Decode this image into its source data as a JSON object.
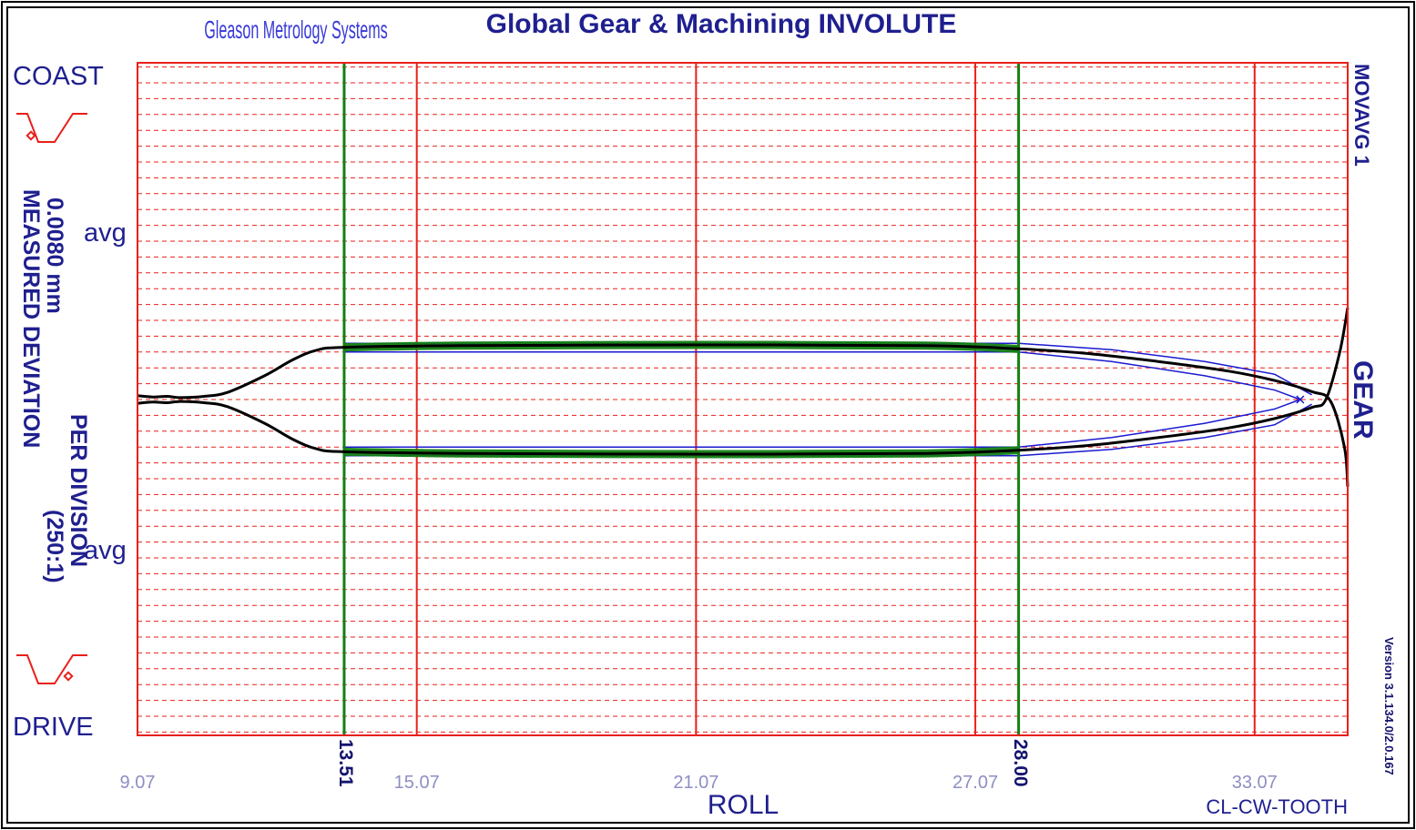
{
  "header": {
    "company": "Gleason Metrology Systems",
    "title": "Global Gear & Machining  INVOLUTE"
  },
  "labels": {
    "coast": "COAST",
    "drive": "DRIVE",
    "avg_top": "avg",
    "avg_bottom": "avg",
    "scale_line1": "0.0080 mm",
    "scale_line2": "MEASURED DEVIATION",
    "scale_line3": "PER DIVISION",
    "scale_line4": "(250:1)",
    "movavg": "MOVAVG 1",
    "gear": "GEAR",
    "version": "Version 3.1.134.0/2.0.167",
    "roll": "ROLL",
    "tooth": "CL-CW-TOOTH"
  },
  "colors": {
    "grid": "#e8201a",
    "eval_lines": "#138013",
    "trace": "#000000",
    "tolerance": "#1a1ad0",
    "text": "#1f1f8f",
    "tick_text": "#8e8ec4"
  },
  "chart_data": {
    "type": "line",
    "xlabel": "ROLL",
    "x_ticks": [
      "9.07",
      "15.07",
      "21.07",
      "27.07",
      "33.07"
    ],
    "xlim": [
      9.07,
      35.07
    ],
    "eval_start": "13.51",
    "eval_end": "28.00",
    "flanks": [
      {
        "name": "COAST",
        "measured": [
          [
            9.07,
            0.24
          ],
          [
            9.4,
            0.16
          ],
          [
            9.7,
            0.2
          ],
          [
            10.0,
            0.12
          ],
          [
            10.5,
            0.2
          ],
          [
            11.0,
            0.45
          ],
          [
            11.8,
            1.5
          ],
          [
            12.4,
            2.5
          ],
          [
            12.9,
            3.1
          ],
          [
            13.51,
            3.3
          ],
          [
            16.0,
            3.4
          ],
          [
            21.07,
            3.45
          ],
          [
            26.0,
            3.4
          ],
          [
            28.0,
            3.2
          ],
          [
            29.5,
            2.9
          ],
          [
            31.0,
            2.4
          ],
          [
            32.5,
            1.8
          ],
          [
            33.5,
            1.2
          ],
          [
            34.3,
            0.5
          ],
          [
            34.7,
            -0.1
          ],
          [
            35.0,
            -3.0
          ],
          [
            35.07,
            -5.5
          ]
        ],
        "tolerance_upper": [
          [
            13.51,
            3.55
          ],
          [
            28.0,
            3.55
          ],
          [
            30.0,
            3.15
          ],
          [
            32.0,
            2.4
          ],
          [
            33.5,
            1.6
          ],
          [
            34.3,
            0.3
          ]
        ],
        "tolerance_lower": [
          [
            13.51,
            3.0
          ],
          [
            28.0,
            3.0
          ],
          [
            30.0,
            2.4
          ],
          [
            32.0,
            1.5
          ],
          [
            33.5,
            0.6
          ],
          [
            34.05,
            0.0
          ]
        ]
      },
      {
        "name": "DRIVE",
        "measured": [
          [
            9.07,
            -0.24
          ],
          [
            9.4,
            -0.16
          ],
          [
            9.7,
            -0.2
          ],
          [
            10.0,
            -0.12
          ],
          [
            10.5,
            -0.2
          ],
          [
            11.0,
            -0.45
          ],
          [
            11.8,
            -1.5
          ],
          [
            12.4,
            -2.5
          ],
          [
            12.9,
            -3.1
          ],
          [
            13.51,
            -3.3
          ],
          [
            16.0,
            -3.4
          ],
          [
            21.07,
            -3.45
          ],
          [
            26.0,
            -3.4
          ],
          [
            28.0,
            -3.2
          ],
          [
            29.5,
            -2.9
          ],
          [
            31.0,
            -2.4
          ],
          [
            32.5,
            -1.8
          ],
          [
            33.5,
            -1.2
          ],
          [
            34.3,
            -0.5
          ],
          [
            34.6,
            0.0
          ],
          [
            34.9,
            3.0
          ],
          [
            35.07,
            5.8
          ]
        ],
        "tolerance_upper": [
          [
            13.51,
            -3.0
          ],
          [
            28.0,
            -3.0
          ],
          [
            30.0,
            -2.4
          ],
          [
            32.0,
            -1.5
          ],
          [
            33.5,
            -0.6
          ],
          [
            34.05,
            0.0
          ]
        ],
        "tolerance_lower": [
          [
            13.51,
            -3.55
          ],
          [
            28.0,
            -3.55
          ],
          [
            30.0,
            -3.15
          ],
          [
            32.0,
            -2.4
          ],
          [
            33.5,
            -1.6
          ],
          [
            34.3,
            -0.3
          ]
        ]
      }
    ]
  }
}
